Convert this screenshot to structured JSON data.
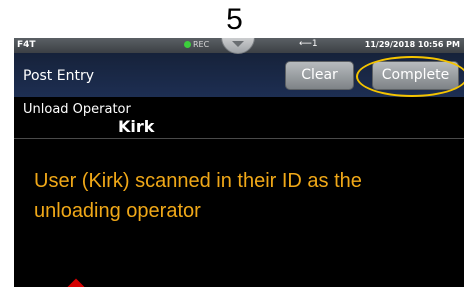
{
  "step_number": "5",
  "status_bar": {
    "device": "F4T",
    "rec_label": "REC",
    "usb_label": "↩−1",
    "datetime": "11/29/2018 10:56 PM"
  },
  "header": {
    "title": "Post Entry",
    "clear_label": "Clear",
    "complete_label": "Complete"
  },
  "field": {
    "label": "Unload Operator",
    "value": "Kirk"
  },
  "annotation": "User (Kirk) scanned in their  ID as the unloading operator",
  "colors": {
    "annotation_text": "#f0a818",
    "highlight": "#f5c400",
    "header_bg": "#1d2e52",
    "rec_indicator": "#3ccf3c",
    "marker": "#d40000"
  },
  "icons": {
    "rec": "green-dot-icon",
    "usb": "usb-icon",
    "pulldown": "chevron-down-icon"
  }
}
